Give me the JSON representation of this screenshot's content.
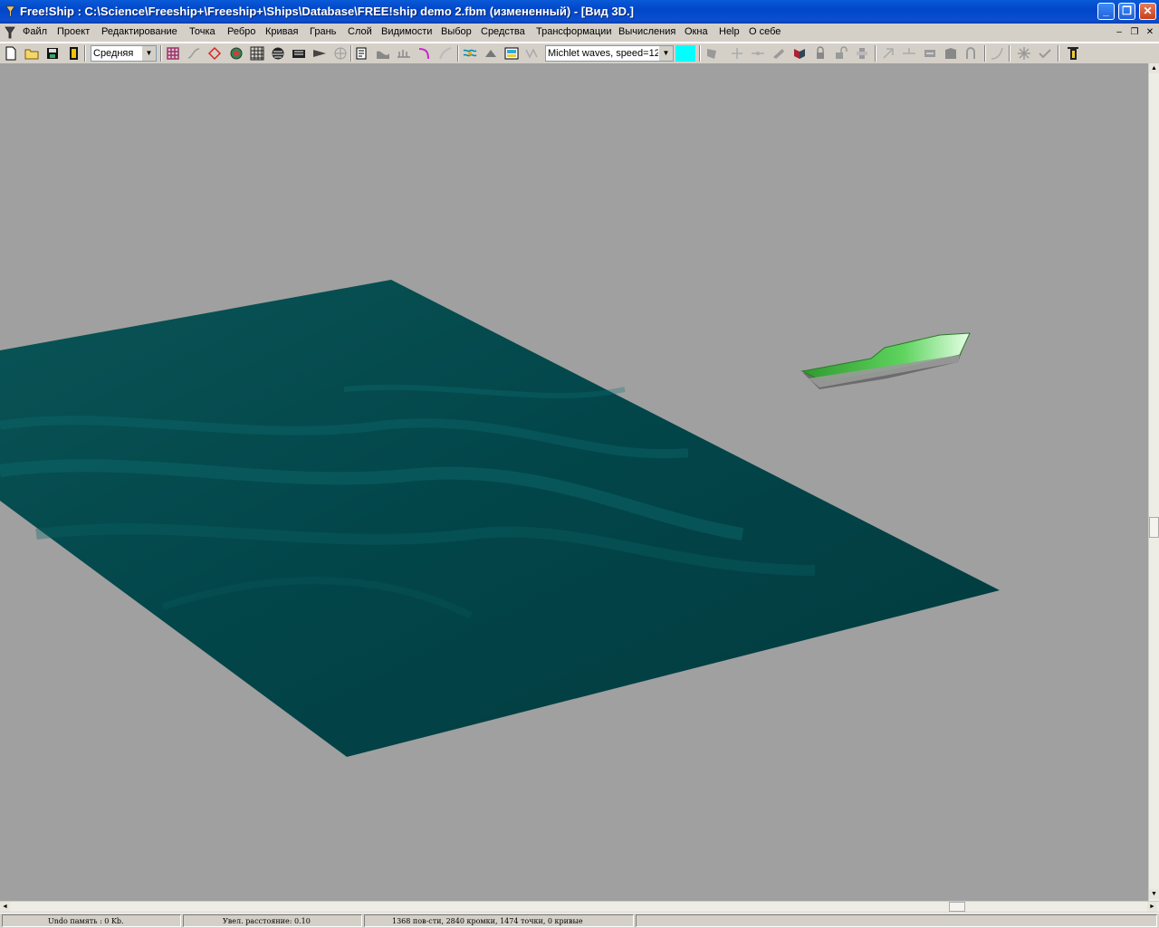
{
  "window": {
    "title": "Free!Ship  : C:\\Science\\Freeship+\\Freeship+\\Ships\\Database\\FREE!ship demo 2.fbm (измененный) - [Вид 3D.]",
    "minimize_label": "_",
    "maximize_label": "❐",
    "close_label": "✕"
  },
  "menu": {
    "items": [
      {
        "label": "Файл"
      },
      {
        "label": "Проект"
      },
      {
        "label": "Редактирование"
      },
      {
        "label": "Точка"
      },
      {
        "label": "Ребро"
      },
      {
        "label": "Кривая"
      },
      {
        "label": "Грань"
      },
      {
        "label": "Слой"
      },
      {
        "label": "Видимости"
      },
      {
        "label": "Выбор"
      },
      {
        "label": "Средства"
      },
      {
        "label": "Трансформации"
      },
      {
        "label": "Вычисления"
      },
      {
        "label": "Окна"
      },
      {
        "label": "Help"
      },
      {
        "label": "О себе"
      }
    ],
    "mdi_minimize": "–",
    "mdi_restore": "❐",
    "mdi_close": "✕"
  },
  "toolbar": {
    "precision_value": "Средняя",
    "shading_value": "Michlet waves, speed=12",
    "swatch_color": "#00ffff",
    "icons": [
      "new-file-icon",
      "open-folder-icon",
      "save-icon",
      "export-icon",
      "control-net-icon",
      "interior-edges-icon",
      "curvature-icon",
      "shade-icon",
      "grid-icon",
      "zebra-icon",
      "gaussian-icon",
      "developability-icon",
      "markers-icon",
      "properties-icon",
      "hydrostatics-icon",
      "station-icon",
      "flowlines-icon",
      "curve-icon",
      "waves-icon",
      "layer-icon",
      "color-icon",
      "heel-icon",
      "point-icon",
      "edge-icon",
      "face-icon",
      "split-icon",
      "lock-icon",
      "unlock-icon",
      "mirror-icon",
      "align-icon",
      "insert-icon",
      "collapse-icon",
      "face-new-icon",
      "crease-icon",
      "curve-add-icon",
      "fit-icon",
      "select-icon",
      "options-icon"
    ]
  },
  "viewport": {
    "background": "#a0a0a0",
    "water_color": "#013e43",
    "hull_color": "#4ec24e"
  },
  "scroll": {
    "up": "▲",
    "down": "▼",
    "left": "◄",
    "right": "►"
  },
  "status": {
    "undo": "Undo память : 0 Kb.",
    "distance": "Увел. расстояние: 0.10",
    "counts": "1368 пов-сти, 2840 кромки, 1474 точки, 0 кривые"
  }
}
